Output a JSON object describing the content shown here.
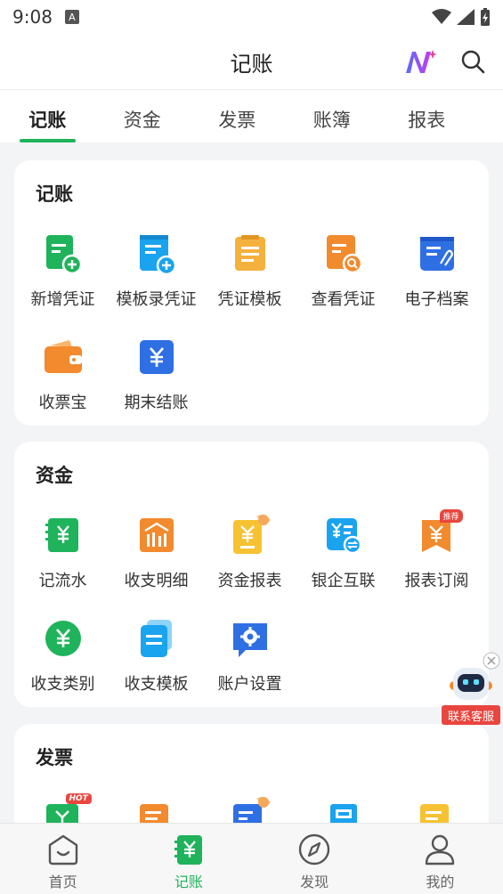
{
  "status": {
    "time": "9:08",
    "indicator": "A"
  },
  "header": {
    "title": "记账",
    "ai_icon": "ai-sparkle-icon",
    "search_icon": "search-icon"
  },
  "tabs": [
    {
      "label": "记账",
      "active": true
    },
    {
      "label": "资金",
      "active": false
    },
    {
      "label": "发票",
      "active": false
    },
    {
      "label": "账簿",
      "active": false
    },
    {
      "label": "报表",
      "active": false
    }
  ],
  "sections": {
    "bookkeeping": {
      "title": "记账",
      "items": [
        {
          "label": "新增凭证",
          "icon": "new-voucher-icon"
        },
        {
          "label": "模板录凭证",
          "icon": "template-voucher-icon"
        },
        {
          "label": "凭证模板",
          "icon": "voucher-template-icon"
        },
        {
          "label": "查看凭证",
          "icon": "view-voucher-icon"
        },
        {
          "label": "电子档案",
          "icon": "e-archive-icon"
        },
        {
          "label": "收票宝",
          "icon": "wallet-icon"
        },
        {
          "label": "期末结账",
          "icon": "period-close-icon"
        }
      ]
    },
    "funds": {
      "title": "资金",
      "items": [
        {
          "label": "记流水",
          "icon": "cash-flow-icon"
        },
        {
          "label": "收支明细",
          "icon": "income-detail-icon"
        },
        {
          "label": "资金报表",
          "icon": "fund-report-icon"
        },
        {
          "label": "银企互联",
          "icon": "bank-link-icon"
        },
        {
          "label": "报表订阅",
          "icon": "report-subscribe-icon",
          "badge": "推荐"
        },
        {
          "label": "收支类别",
          "icon": "category-icon"
        },
        {
          "label": "收支模板",
          "icon": "income-template-icon"
        },
        {
          "label": "账户设置",
          "icon": "account-settings-icon"
        }
      ]
    },
    "invoice": {
      "title": "发票",
      "items": [
        {
          "icon": "invoice-hot-icon",
          "badge": "HOT"
        },
        {
          "icon": "invoice-orange-icon"
        },
        {
          "icon": "invoice-blue-icon"
        },
        {
          "icon": "invoice-scan-icon"
        },
        {
          "icon": "invoice-yellow-icon"
        }
      ]
    }
  },
  "service": {
    "label": "联系客服"
  },
  "bottom_nav": [
    {
      "label": "首页",
      "icon": "home-icon",
      "active": false
    },
    {
      "label": "记账",
      "icon": "bookkeeping-icon",
      "active": true
    },
    {
      "label": "发现",
      "icon": "compass-icon",
      "active": false
    },
    {
      "label": "我的",
      "icon": "profile-icon",
      "active": false
    }
  ],
  "colors": {
    "accent": "#1fb35b",
    "orange": "#f28a2e",
    "blue": "#2f6fe4",
    "yellow": "#f7c232",
    "sky": "#1aa3ef",
    "red": "#e8463f"
  }
}
